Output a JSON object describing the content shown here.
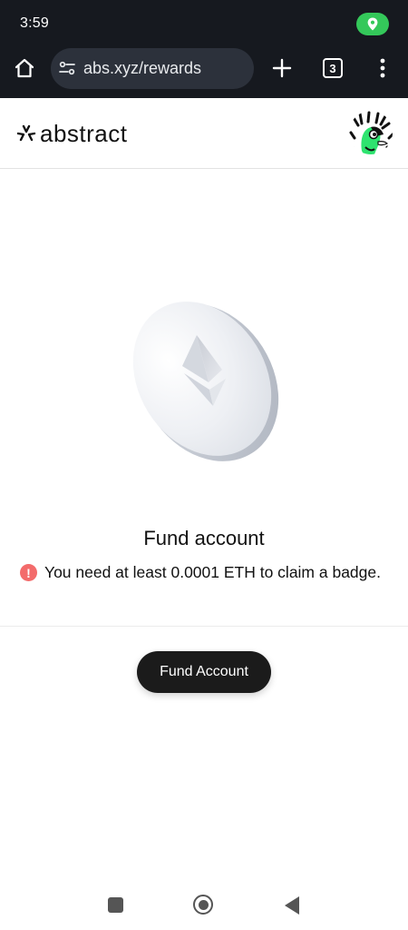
{
  "status_bar": {
    "time": "3:59"
  },
  "browser": {
    "url": "abs.xyz/rewards",
    "tab_count": "3"
  },
  "site": {
    "logo_text": "abstract"
  },
  "content": {
    "title": "Fund account",
    "warning": "You need at least 0.0001 ETH to claim a badge.",
    "warning_icon": "!",
    "button_label": "Fund Account"
  },
  "colors": {
    "browser_chrome": "#16191f",
    "url_bar": "#2c313b",
    "location_pill": "#34c85a",
    "warning_icon": "#f36b6b",
    "primary_button": "#1b1b1b"
  }
}
